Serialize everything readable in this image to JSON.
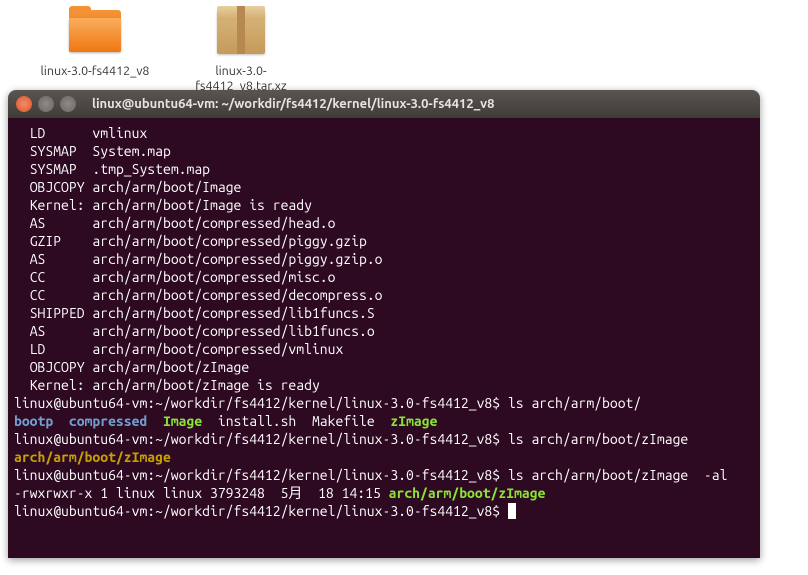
{
  "desktop": {
    "folder_label": "linux-3.0-fs4412_v8",
    "package_label": "linux-3.0-fs4412_v8.tar.xz"
  },
  "window": {
    "title": "linux@ubuntu64-vm: ~/workdir/fs4412/kernel/linux-3.0-fs4412_v8"
  },
  "prompt": {
    "user_host": "linux@ubuntu64-vm",
    "sep": ":",
    "path": "~/workdir/fs4412/kernel/linux-3.0-fs4412_v8",
    "end": "$"
  },
  "build": [
    {
      "tag": "LD",
      "file": "vmlinux"
    },
    {
      "tag": "SYSMAP",
      "file": "System.map"
    },
    {
      "tag": "SYSMAP",
      "file": ".tmp_System.map"
    },
    {
      "tag": "OBJCOPY",
      "file": "arch/arm/boot/Image"
    },
    {
      "tag": "Kernel:",
      "file": "arch/arm/boot/Image is ready"
    },
    {
      "tag": "AS",
      "file": "arch/arm/boot/compressed/head.o"
    },
    {
      "tag": "GZIP",
      "file": "arch/arm/boot/compressed/piggy.gzip"
    },
    {
      "tag": "AS",
      "file": "arch/arm/boot/compressed/piggy.gzip.o"
    },
    {
      "tag": "CC",
      "file": "arch/arm/boot/compressed/misc.o"
    },
    {
      "tag": "CC",
      "file": "arch/arm/boot/compressed/decompress.o"
    },
    {
      "tag": "SHIPPED",
      "file": "arch/arm/boot/compressed/lib1funcs.S"
    },
    {
      "tag": "AS",
      "file": "arch/arm/boot/compressed/lib1funcs.o"
    },
    {
      "tag": "LD",
      "file": "arch/arm/boot/compressed/vmlinux"
    },
    {
      "tag": "OBJCOPY",
      "file": "arch/arm/boot/zImage"
    },
    {
      "tag": "Kernel:",
      "file": "arch/arm/boot/zImage is ready"
    }
  ],
  "cmd1": "ls arch/arm/boot/",
  "ls_out1": {
    "bootp": {
      "text": "bootp",
      "class": "c-blue"
    },
    "compressed": {
      "text": "compressed",
      "class": "c-blue"
    },
    "image": {
      "text": "Image",
      "class": "c-green"
    },
    "install": {
      "text": "install.sh",
      "class": "c-white"
    },
    "makefile": {
      "text": "Makefile",
      "class": "c-white"
    },
    "zimage": {
      "text": "zImage",
      "class": "c-green"
    }
  },
  "cmd2": "ls arch/arm/boot/zImage",
  "out2": "arch/arm/boot/zImage",
  "cmd3": "ls arch/arm/boot/zImage  -al",
  "out3_prefix": "-rwxrwxr-x 1 linux linux 3793248  5月  18 14:15 ",
  "out3_path": "arch/arm/boot/zImage"
}
